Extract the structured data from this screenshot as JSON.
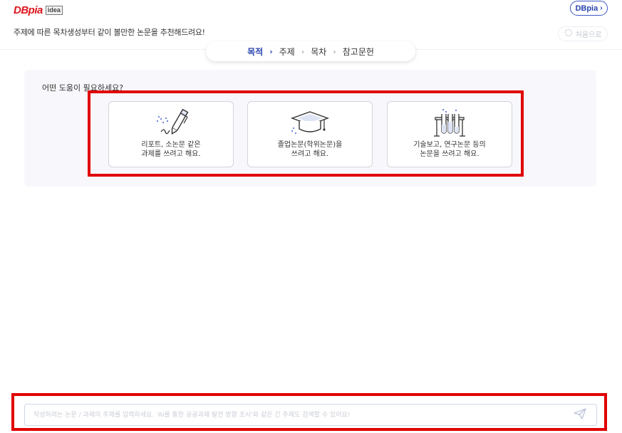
{
  "header": {
    "logo_text": "DBpia",
    "logo_badge": "idea",
    "dbpia_button": "DBpia",
    "subtitle": "주제에 따른 목차생성부터 같이 볼만한 논문을 추천해드려요!",
    "reset_button": "처음으로"
  },
  "steps": [
    {
      "label": "목적",
      "active": true
    },
    {
      "label": "주제",
      "active": false
    },
    {
      "label": "목차",
      "active": false
    },
    {
      "label": "참고문헌",
      "active": false
    }
  ],
  "panel": {
    "question": "어떤 도움이 필요하세요?",
    "cards": [
      {
        "icon": "pen-icon",
        "label": "리포트, 소논문 같은\n과제를 쓰려고 해요."
      },
      {
        "icon": "graduation-cap-icon",
        "label": "졸업논문(학위논문)을\n쓰려고 해요."
      },
      {
        "icon": "test-tubes-icon",
        "label": "기술보고, 연구논문 등의\n논문을 쓰려고 해요."
      }
    ]
  },
  "search": {
    "placeholder": "작성하려는 논문 / 과제의 주제를 입력하세요. 'AI를 통한 공공과제 발전 방향 조사'와 같은 긴 주제도 검색할 수 있어요!",
    "value": ""
  },
  "colors": {
    "brand_red": "#e0141e",
    "accent_blue": "#2a44b0",
    "annotation_red": "#e00000"
  }
}
